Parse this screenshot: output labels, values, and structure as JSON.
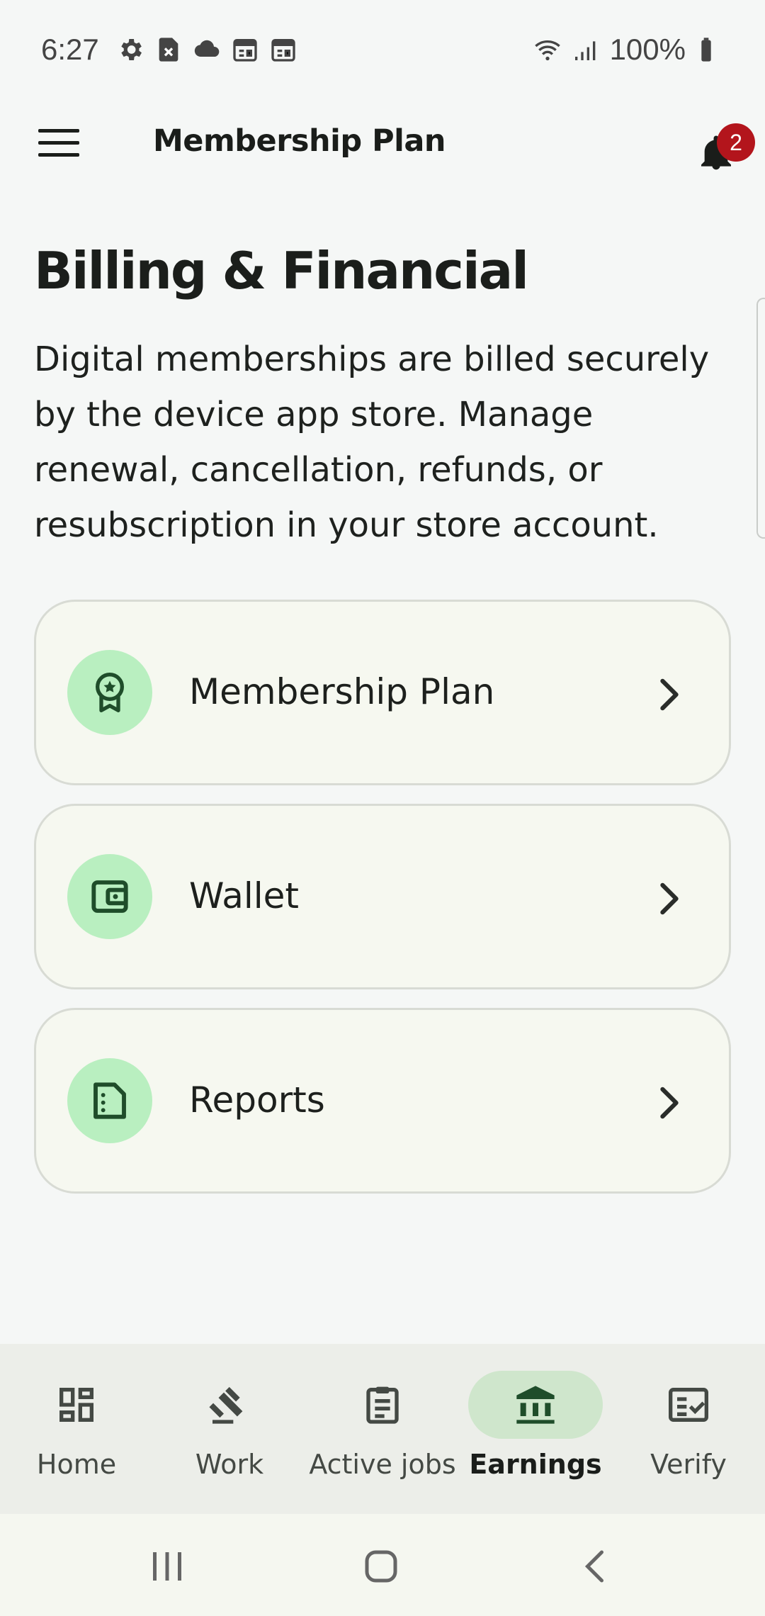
{
  "status_bar": {
    "time": "6:27",
    "battery": "100%",
    "icons_left": [
      "settings-icon",
      "sim-error-icon",
      "cloud-icon",
      "calendar-icon",
      "calendar-icon"
    ],
    "icons_right": [
      "wifi-icon",
      "signal-icon",
      "battery-icon"
    ]
  },
  "app_bar": {
    "title": "Membership Plan",
    "notification_count": "2"
  },
  "page": {
    "heading": "Billing & Financial",
    "description": "Digital memberships are billed securely by the device app store. Manage renewal, cancellation, refunds, or resubscription in your store account."
  },
  "cards": [
    {
      "label": "Membership Plan",
      "icon": "award-ribbon-icon"
    },
    {
      "label": "Wallet",
      "icon": "wallet-icon"
    },
    {
      "label": "Reports",
      "icon": "report-document-icon"
    }
  ],
  "bottom_nav": {
    "active": "Earnings",
    "items": [
      {
        "label": "Home",
        "icon": "dashboard-icon"
      },
      {
        "label": "Work",
        "icon": "gavel-icon"
      },
      {
        "label": "Active jobs",
        "icon": "clipboard-icon"
      },
      {
        "label": "Earnings",
        "icon": "bank-icon"
      },
      {
        "label": "Verify",
        "icon": "fact-check-icon"
      }
    ]
  },
  "colors": {
    "accent_green": "#b9efc0",
    "active_pill": "#cfe6cc",
    "icon_dark_green": "#1f4d2a",
    "badge_red": "#b3151c"
  }
}
